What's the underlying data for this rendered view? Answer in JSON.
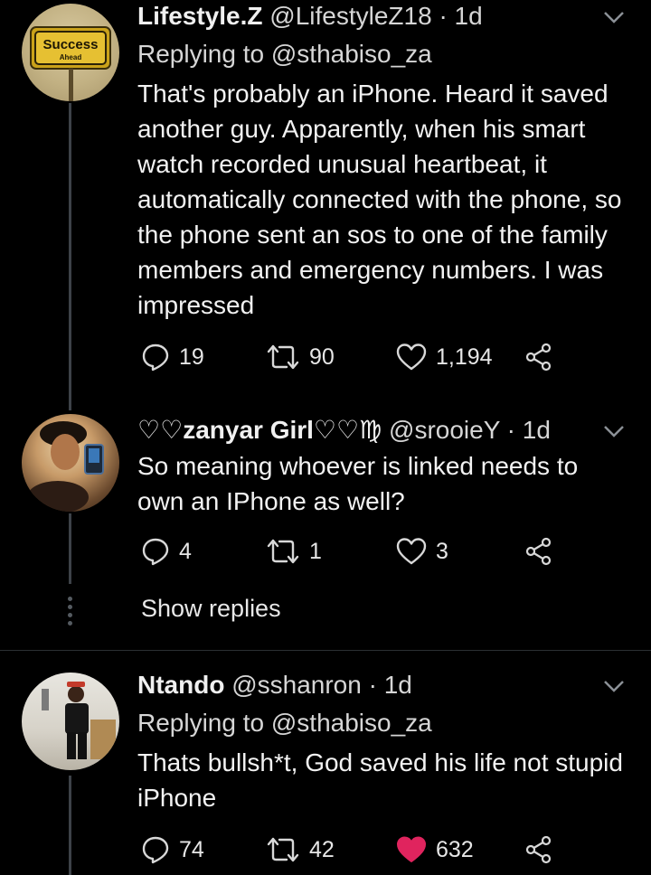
{
  "tweets": [
    {
      "name": "Lifestyle.Z",
      "handle": "@LifestyleZ18",
      "separator": "·",
      "time": "1d",
      "replying_to": "Replying to @sthabiso_za",
      "text": "That's probably an iPhone. Heard it saved another guy. Apparently, when his smart watch recorded unusual heartbeat, it automatically connected with the phone, so the phone sent an sos to one of the family members and emergency numbers. I was impressed",
      "replies": "19",
      "retweets": "90",
      "likes": "1,194",
      "avatar_sign_text": "Success",
      "avatar_sign_sub": "Ahead"
    },
    {
      "name": "♡♡zanyar Girl♡♡♍",
      "handle": "@srooieY",
      "separator": "·",
      "time": "1d",
      "text": "So meaning whoever is linked needs to own an IPhone as well?",
      "replies": "4",
      "retweets": "1",
      "likes": "3",
      "show_replies": "Show replies"
    },
    {
      "name": "Ntando",
      "handle": "@sshanron",
      "separator": "·",
      "time": "1d",
      "replying_to": "Replying to @sthabiso_za",
      "text": "Thats bullsh*t, God saved his life not stupid iPhone",
      "replies": "74",
      "retweets": "42",
      "likes": "632",
      "liked": true
    }
  ],
  "colors": {
    "background": "#000000",
    "like_active": "#e0245e",
    "icon": "#d8d8d8",
    "thread_line": "#3d4248"
  },
  "icons": [
    "reply-icon",
    "retweet-icon",
    "like-icon",
    "share-icon",
    "chevron-down-icon"
  ]
}
